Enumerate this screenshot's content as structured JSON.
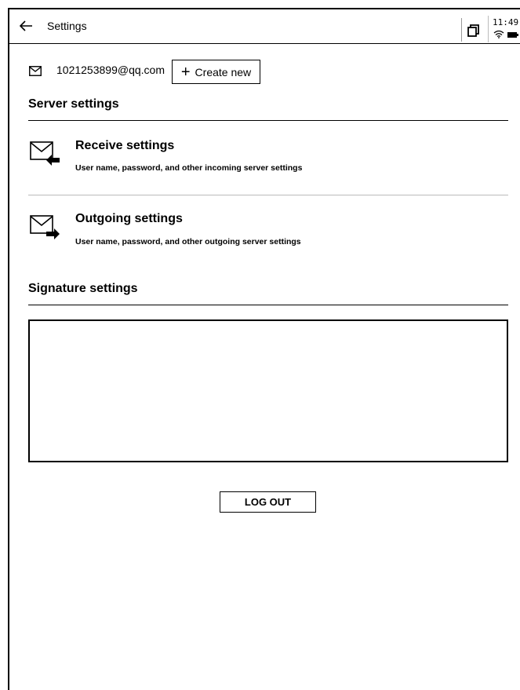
{
  "header": {
    "title": "Settings",
    "clock": "11:49"
  },
  "account": {
    "email": "1021253899@qq.com",
    "create_label": "Create new"
  },
  "server": {
    "section_title": "Server settings",
    "receive": {
      "title": "Receive settings",
      "description": "User name, password, and other incoming server settings"
    },
    "outgoing": {
      "title": "Outgoing settings",
      "description": "User name, password, and other outgoing server settings"
    }
  },
  "signature": {
    "section_title": "Signature settings",
    "value": ""
  },
  "logout_label": "LOG OUT"
}
